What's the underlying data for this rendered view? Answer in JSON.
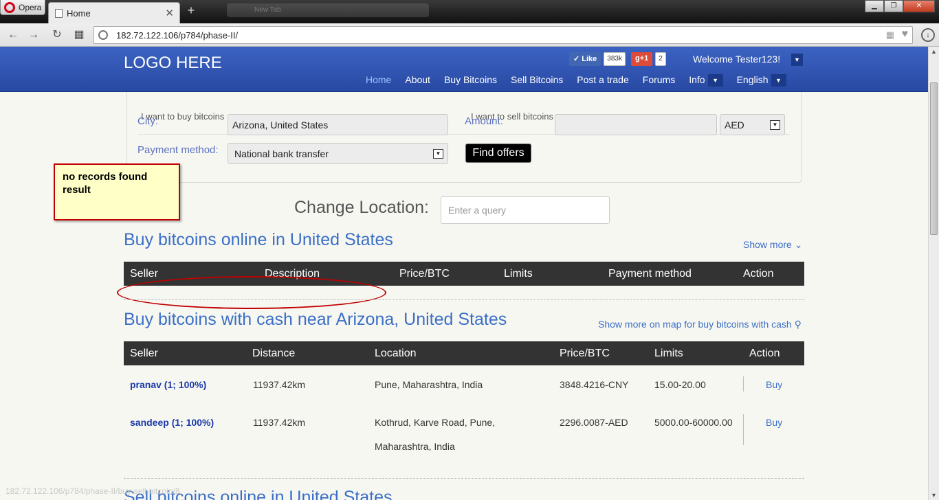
{
  "browser": {
    "menu_label": "Opera",
    "tab_title": "Home",
    "ghost_tab_title": "New Tab",
    "url": "182.72.122.106/p784/phase-II/",
    "status_url": "182.72.122.106/p784/phase-II/buy-sell-bitcoin/8"
  },
  "header": {
    "logo": "LOGO HERE",
    "like_label": "Like",
    "like_count": "383k",
    "gplus_label": "g+1",
    "gplus_count": "2",
    "welcome": "Welcome Tester123!",
    "nav": [
      "Home",
      "About",
      "Buy Bitcoins",
      "Sell Bitcoins",
      "Post a trade",
      "Forums",
      "Info",
      "English"
    ]
  },
  "search": {
    "buy_radio": "I want to buy bitcoins",
    "sell_radio": "I want to sell bitcoins",
    "city_label": "City:",
    "city_value": "Arizona, United States",
    "amount_label": "Amount:",
    "amount_value": "",
    "currency": "AED",
    "payment_label": "Payment method:",
    "payment_value": "National bank transfer",
    "find_button": "Find offers"
  },
  "annotation": {
    "note": "no records found result"
  },
  "location": {
    "label": "Change Location:",
    "placeholder": "Enter a query"
  },
  "online_section": {
    "title": "Buy bitcoins online in United States",
    "show_more": "Show more",
    "columns": [
      "Seller",
      "Description",
      "Price/BTC",
      "Limits",
      "Payment method",
      "Action"
    ]
  },
  "cash_section": {
    "title": "Buy bitcoins with cash near Arizona, United States",
    "show_more": "Show more on map for buy bitcoins with cash",
    "columns": [
      "Seller",
      "Distance",
      "Location",
      "Price/BTC",
      "Limits",
      "Action"
    ],
    "rows": [
      {
        "seller": "pranav (1; 100%)",
        "distance": "11937.42km",
        "location_line1": "Pune, Maharashtra, India",
        "location_line2": "",
        "price": "3848.4216-CNY",
        "limits": "15.00-20.00",
        "action": "Buy"
      },
      {
        "seller": "sandeep (1; 100%)",
        "distance": "11937.42km",
        "location_line1": "Kothrud, Karve Road, Pune,",
        "location_line2": "Maharashtra, India",
        "price": "2296.0087-AED",
        "limits": "5000.00-60000.00",
        "action": "Buy"
      }
    ]
  },
  "sell_section": {
    "title": "Sell bitcoins online in United States"
  }
}
